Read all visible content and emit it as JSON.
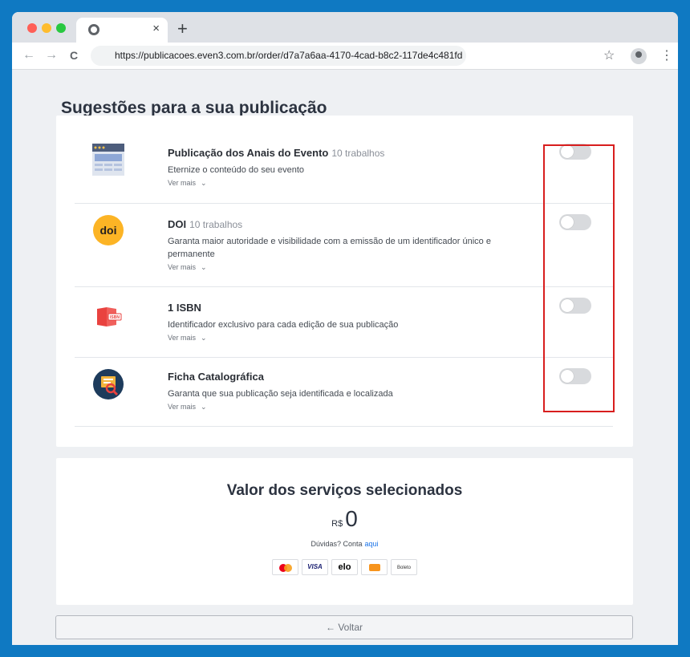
{
  "browser": {
    "tab_close": "×",
    "new_tab": "+",
    "back": "←",
    "forward": "→",
    "reload": "C",
    "url": "https://publicacoes.even3.com.br/order/d7a7a6aa-4170-4cad-b8c2-117de4c481fd",
    "star": "☆",
    "menu": "⋮"
  },
  "page": {
    "heading": "Sugestões para a sua publicação",
    "suggestions": [
      {
        "title": "Publicação dos Anais do Evento",
        "count": "10 trabalhos",
        "description": "Eternize o conteúdo do seu evento",
        "more": "Ver mais",
        "enabled": false
      },
      {
        "title": "DOI",
        "count": "10 trabalhos",
        "description": "Garanta maior autoridade e visibilidade com a emissão de um identificador único e permanente",
        "more": "Ver mais",
        "enabled": false
      },
      {
        "title": "1 ISBN",
        "count": "",
        "description": "Identificador exclusivo para cada edição de sua publicação",
        "more": "Ver mais",
        "enabled": false
      },
      {
        "title": "Ficha Catalográfica",
        "count": "",
        "description": "Garanta que sua publicação seja identificada e localizada",
        "more": "Ver mais",
        "enabled": false
      }
    ],
    "chevron": "⌄",
    "doi_logo": "doi",
    "isbn_logo": "ISBN",
    "total": {
      "title": "Valor dos serviços selecionados",
      "currency": "R$",
      "value": "0",
      "help_text": "Dúvidas? Conta",
      "help_link": "aqui"
    },
    "payment": {
      "visa": "VISA",
      "elo": "elo",
      "boleto": "Boleto"
    },
    "back_button": "← Voltar"
  },
  "colors": {
    "accent": "#1a73e8",
    "highlight_box": "#d81e1e",
    "background": "#0f79c2"
  }
}
